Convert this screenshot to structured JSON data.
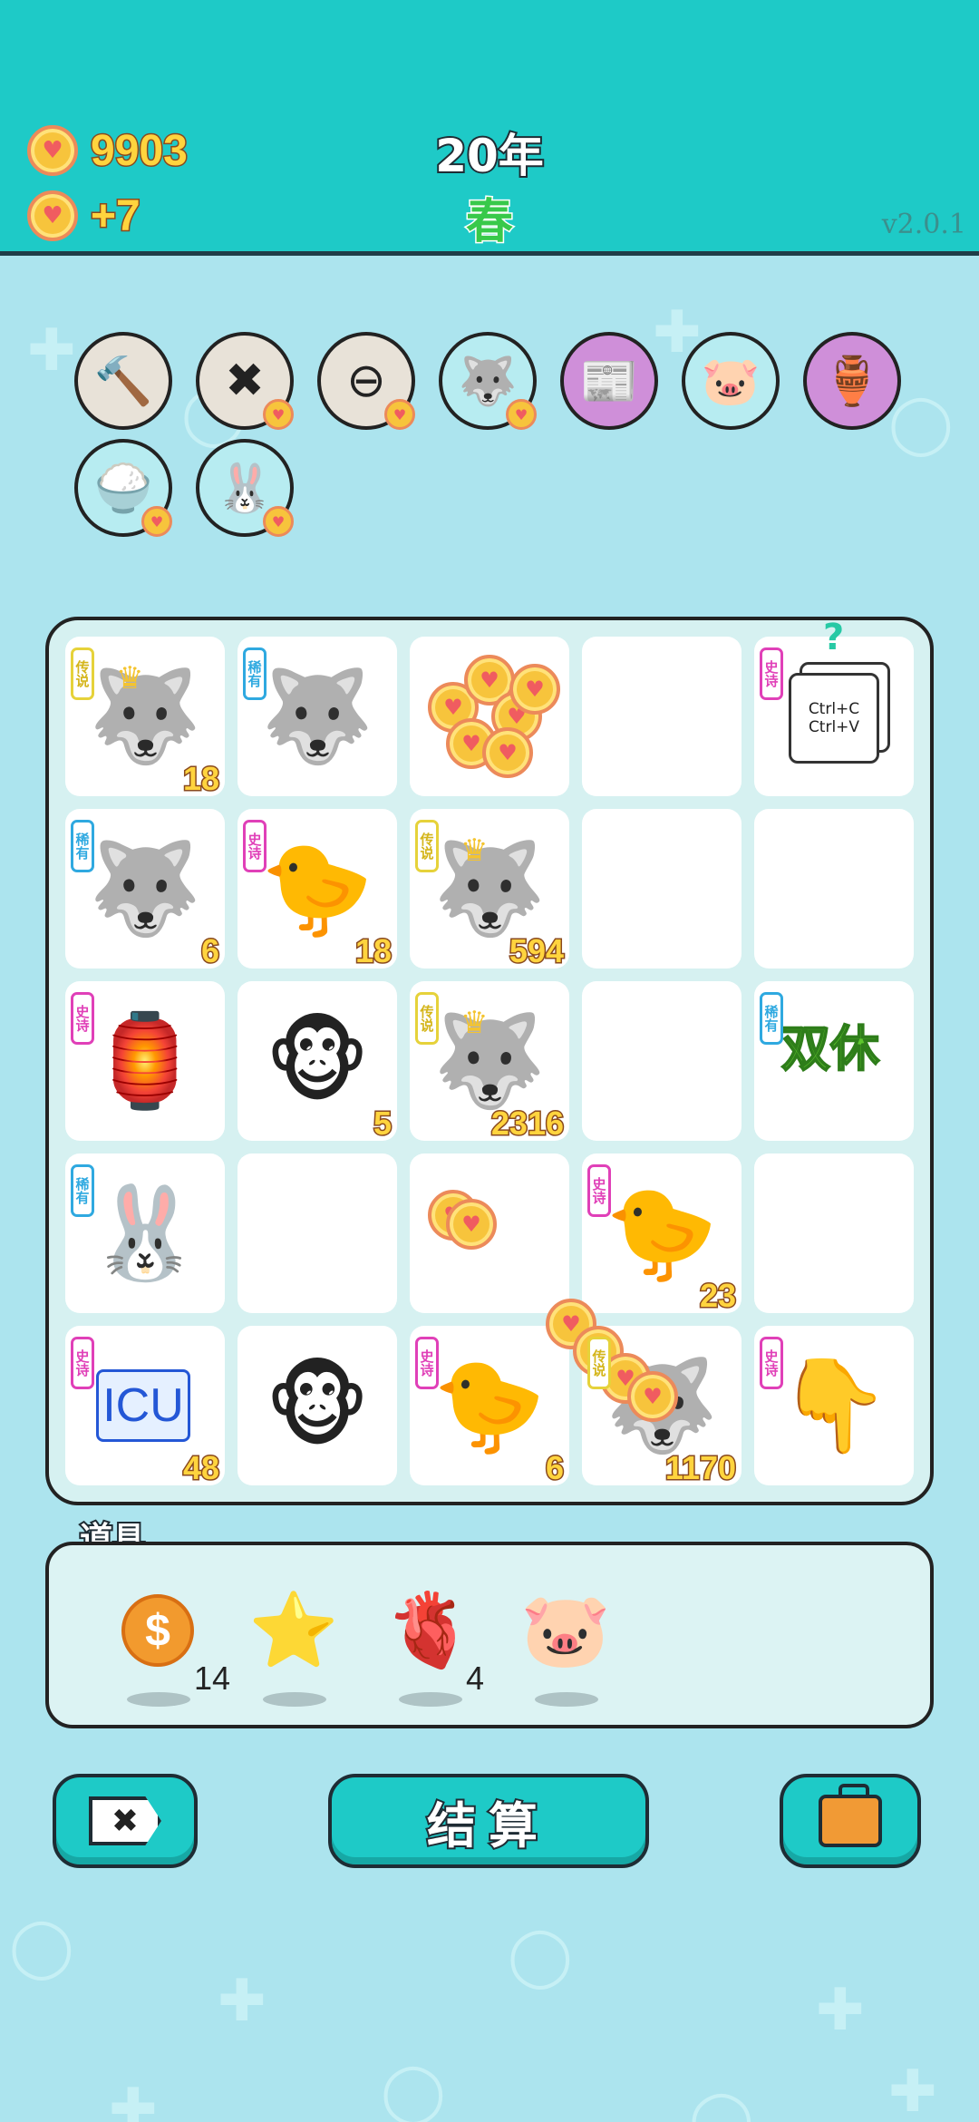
{
  "header": {
    "coins": "9903",
    "income": "+7",
    "year": "20年",
    "season": "春",
    "version": "v2.0.1"
  },
  "relics": [
    {
      "name": "hammer-icon",
      "glyph": "🔨",
      "bg": "#e8e2d8",
      "badge": false
    },
    {
      "name": "delete-tag-icon",
      "glyph": "✖",
      "bg": "#e8e2d8",
      "badge": true
    },
    {
      "name": "no-entry-icon",
      "glyph": "⊖",
      "bg": "#e8e2d8",
      "badge": true
    },
    {
      "name": "husky-icon",
      "glyph": "🐺",
      "bg": "#b7ecf1",
      "badge": true
    },
    {
      "name": "time-magazine-icon",
      "glyph": "📰",
      "bg": "#cf8fd9",
      "badge": false
    },
    {
      "name": "piggy-bank-icon",
      "glyph": "🐷",
      "bg": "#b7ecf1",
      "badge": false
    },
    {
      "name": "jar-icon",
      "glyph": "🏺",
      "bg": "#cf8fd9",
      "badge": false
    },
    {
      "name": "rice-bowl-icon",
      "glyph": "🍚",
      "bg": "#b7ecf1",
      "badge": true
    },
    {
      "name": "rabbit-icon",
      "glyph": "🐰",
      "bg": "#b7ecf1",
      "badge": true
    }
  ],
  "tags": {
    "legend": "传说",
    "rare": "稀有",
    "epic": "史诗"
  },
  "board": [
    [
      {
        "kind": "husky-king",
        "tag": "legend",
        "num": "18"
      },
      {
        "kind": "husky",
        "tag": "rare",
        "num": ""
      },
      {
        "kind": "coins",
        "tag": "",
        "num": ""
      },
      {
        "kind": "empty",
        "tag": "",
        "num": ""
      },
      {
        "kind": "ctrl",
        "tag": "epic",
        "num": ""
      }
    ],
    [
      {
        "kind": "husky",
        "tag": "rare",
        "num": "6"
      },
      {
        "kind": "chick",
        "tag": "epic",
        "num": "18"
      },
      {
        "kind": "husky-king",
        "tag": "legend",
        "num": "594"
      },
      {
        "kind": "empty",
        "tag": "",
        "num": ""
      },
      {
        "kind": "empty",
        "tag": "",
        "num": ""
      }
    ],
    [
      {
        "kind": "rabbit-house",
        "tag": "epic",
        "num": ""
      },
      {
        "kind": "monkey",
        "tag": "",
        "num": "5"
      },
      {
        "kind": "husky-king",
        "tag": "legend",
        "num": "2316"
      },
      {
        "kind": "empty",
        "tag": "",
        "num": ""
      },
      {
        "kind": "shuangxiu",
        "tag": "rare",
        "num": ""
      }
    ],
    [
      {
        "kind": "rabbit",
        "tag": "rare",
        "num": ""
      },
      {
        "kind": "empty",
        "tag": "",
        "num": ""
      },
      {
        "kind": "coins-small",
        "tag": "",
        "num": ""
      },
      {
        "kind": "chick",
        "tag": "epic",
        "num": "23"
      },
      {
        "kind": "empty",
        "tag": "",
        "num": ""
      }
    ],
    [
      {
        "kind": "icu",
        "tag": "epic",
        "num": "48"
      },
      {
        "kind": "monkey",
        "tag": "",
        "num": ""
      },
      {
        "kind": "chick",
        "tag": "epic",
        "num": "6"
      },
      {
        "kind": "husky-coins",
        "tag": "legend",
        "num": "1170"
      },
      {
        "kind": "pointer",
        "tag": "epic",
        "num": ""
      }
    ]
  ],
  "cell_text": {
    "ctrl_c": "Ctrl+C",
    "ctrl_v": "Ctrl+V",
    "question": "?",
    "shuangxiu": "双休",
    "icu": "ICU"
  },
  "items": {
    "title": "道具",
    "list": [
      {
        "name": "dollar-coin-icon",
        "glyph": "$",
        "count": "14"
      },
      {
        "name": "star-icon",
        "glyph": "⭐",
        "count": ""
      },
      {
        "name": "liver-icon",
        "glyph": "🫀",
        "count": "4"
      },
      {
        "name": "piggy-bank-icon",
        "glyph": "🐷",
        "count": ""
      }
    ]
  },
  "buttons": {
    "delete": "✖",
    "settle": "结算",
    "bag": "briefcase-icon"
  },
  "glyphs": {
    "heart": "♥",
    "husky": "🐺",
    "chick": "🐤",
    "monkey": "🐵",
    "rabbit": "🐰",
    "house": "🏮",
    "pointer": "👇",
    "crown": "♛"
  }
}
